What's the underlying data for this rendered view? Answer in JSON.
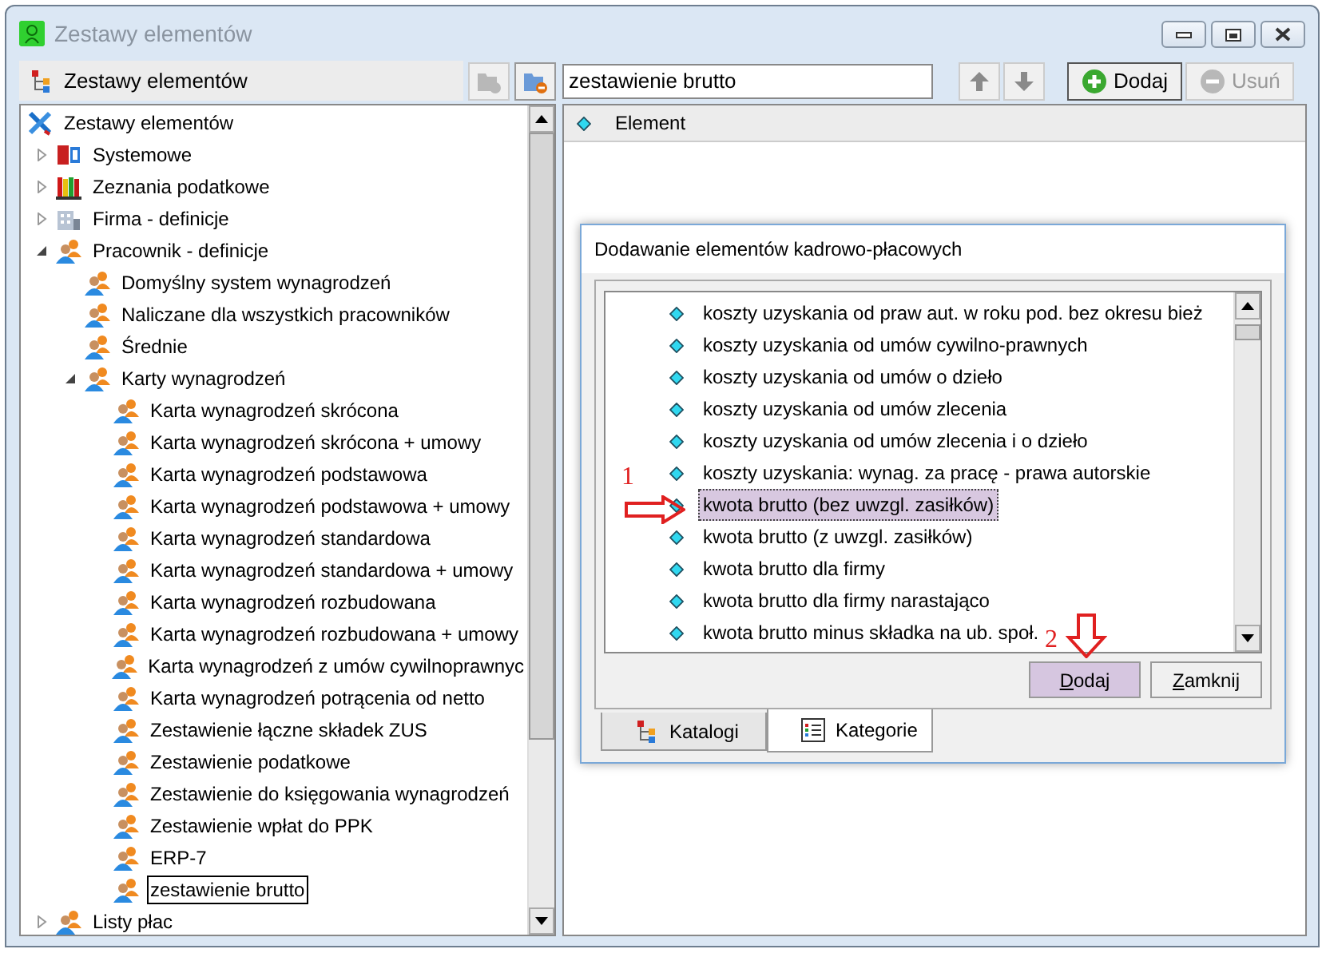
{
  "window": {
    "title": "Zestawy elementów"
  },
  "left_panel": {
    "title": "Zestawy elementów",
    "buttons": [
      {
        "kind": "folder-add",
        "disabled": true
      },
      {
        "kind": "folder-remove",
        "disabled": false
      }
    ]
  },
  "tree": [
    {
      "label": "Zestawy elementów",
      "kind": "tools",
      "selected": false,
      "children": [
        {
          "label": "Systemowe",
          "kind": "blocks",
          "expanded": false,
          "selected": false
        },
        {
          "label": "Zeznania podatkowe",
          "kind": "books",
          "expanded": false,
          "selected": false
        },
        {
          "label": "Firma - definicje",
          "kind": "building",
          "expanded": false,
          "selected": false
        },
        {
          "label": "Pracownik - definicje",
          "kind": "people",
          "expanded": true,
          "selected": false,
          "children": [
            {
              "label": "Domyślny system wynagrodzeń",
              "kind": "people",
              "selected": false
            },
            {
              "label": "Naliczane dla wszystkich pracowników",
              "kind": "people",
              "selected": false
            },
            {
              "label": "Średnie",
              "kind": "people",
              "selected": false
            },
            {
              "label": "Karty wynagrodzeń",
              "kind": "people",
              "expanded": true,
              "selected": false,
              "children": [
                {
                  "label": "Karta wynagrodzeń skrócona",
                  "kind": "people",
                  "selected": false
                },
                {
                  "label": "Karta wynagrodzeń skrócona + umowy",
                  "kind": "people",
                  "selected": false
                },
                {
                  "label": "Karta wynagrodzeń podstawowa",
                  "kind": "people",
                  "selected": false
                },
                {
                  "label": "Karta wynagrodzeń podstawowa + umowy",
                  "kind": "people",
                  "selected": false
                },
                {
                  "label": "Karta wynagrodzeń standardowa",
                  "kind": "people",
                  "selected": false
                },
                {
                  "label": "Karta wynagrodzeń standardowa + umowy",
                  "kind": "people",
                  "selected": false
                },
                {
                  "label": "Karta wynagrodzeń rozbudowana",
                  "kind": "people",
                  "selected": false
                },
                {
                  "label": "Karta wynagrodzeń rozbudowana + umowy",
                  "kind": "people",
                  "selected": false
                },
                {
                  "label": "Karta wynagrodzeń z umów cywilnoprawnyc",
                  "kind": "people",
                  "selected": false
                },
                {
                  "label": "Karta wynagrodzeń potrącenia od netto",
                  "kind": "people",
                  "selected": false
                },
                {
                  "label": "Zestawienie łączne składek ZUS",
                  "kind": "people",
                  "selected": false
                },
                {
                  "label": "Zestawienie podatkowe",
                  "kind": "people",
                  "selected": false
                },
                {
                  "label": "Zestawienie do księgowania wynagrodzeń",
                  "kind": "people",
                  "selected": false
                },
                {
                  "label": "Zestawienie wpłat do PPK",
                  "kind": "people",
                  "selected": false
                },
                {
                  "label": "ERP-7",
                  "kind": "people",
                  "selected": false
                },
                {
                  "label": "zestawienie brutto",
                  "kind": "people",
                  "selected": true
                }
              ]
            }
          ]
        },
        {
          "label": "Listy płac",
          "kind": "people",
          "expanded": false,
          "selected": false
        }
      ]
    }
  ],
  "right_panel": {
    "name_field": "zestawienie brutto",
    "buttons": [
      {
        "kind": "up",
        "disabled": true
      },
      {
        "kind": "down",
        "disabled": true
      },
      {
        "kind": "add",
        "label": "Dodaj",
        "disabled": false
      },
      {
        "kind": "remove",
        "label": "Usuń",
        "disabled": true
      }
    ],
    "columns": [
      "Element"
    ]
  },
  "dialog": {
    "title": "Dodawanie elementów kadrowo-płacowych",
    "items": [
      {
        "label": "koszty uzyskania od praw aut. w roku pod. bez okresu bież",
        "selected": false
      },
      {
        "label": "koszty uzyskania od umów cywilno-prawnych",
        "selected": false
      },
      {
        "label": "koszty uzyskania od umów o dzieło",
        "selected": false
      },
      {
        "label": "koszty uzyskania od umów zlecenia",
        "selected": false
      },
      {
        "label": "koszty uzyskania od umów zlecenia i o dzieło",
        "selected": false
      },
      {
        "label": "koszty uzyskania: wynag. za pracę - prawa autorskie",
        "selected": false
      },
      {
        "label": "kwota brutto (bez uwzgl. zasiłków)",
        "selected": true
      },
      {
        "label": "kwota brutto (z uwzgl. zasiłków)",
        "selected": false
      },
      {
        "label": "kwota brutto dla firmy",
        "selected": false
      },
      {
        "label": "kwota brutto dla firmy narastająco",
        "selected": false
      },
      {
        "label": "kwota brutto minus składka na ub. społ.",
        "selected": false
      }
    ],
    "buttons": [
      {
        "label": "Dodaj",
        "highlighted": true
      },
      {
        "label": "Zamknij",
        "highlighted": false
      }
    ],
    "tabs": [
      {
        "label": "Katalogi",
        "kind": "tree",
        "selected": false
      },
      {
        "label": "Kategorie",
        "kind": "list",
        "selected": true
      }
    ]
  },
  "annotations": [
    {
      "label": "1",
      "kind": "right"
    },
    {
      "label": "2",
      "kind": "down"
    }
  ]
}
